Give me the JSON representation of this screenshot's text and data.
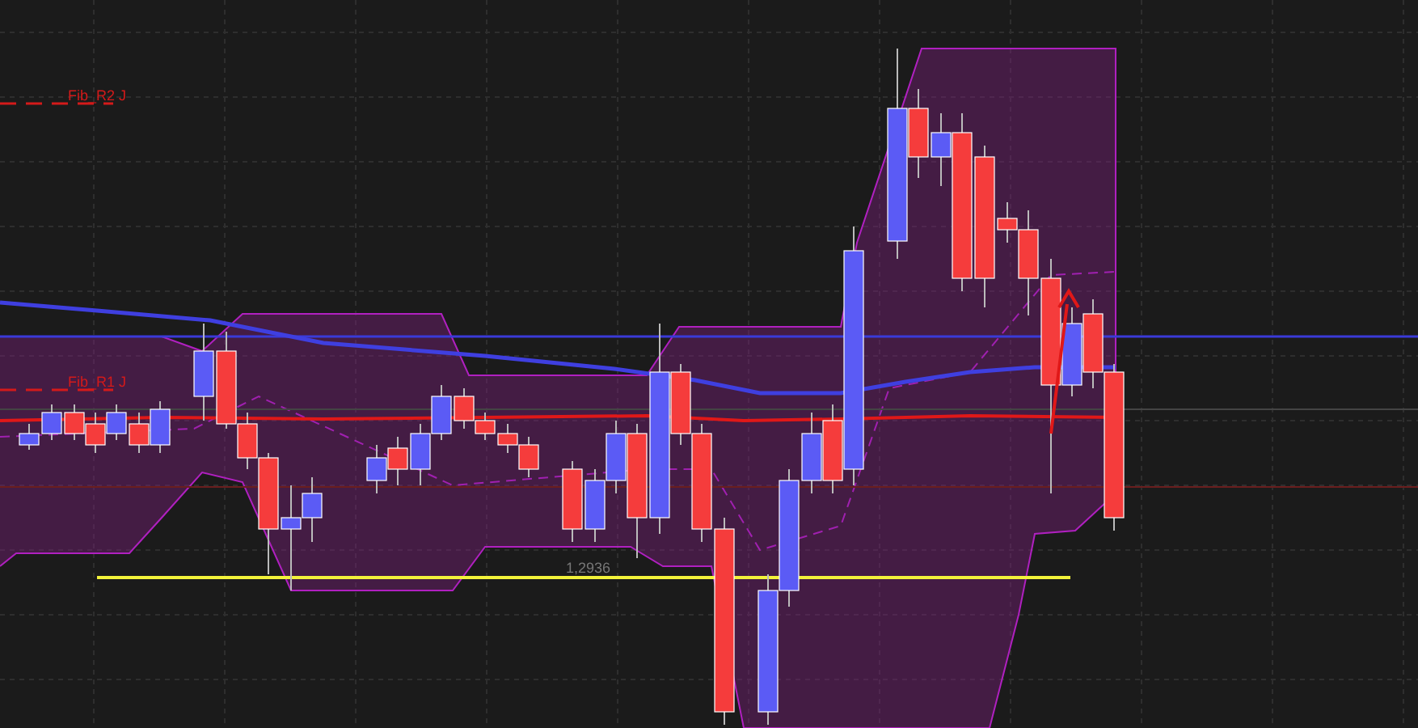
{
  "chart": {
    "labels": [
      {
        "kind": "fib_r2",
        "text": "Fib_R2 J"
      },
      {
        "kind": "fib_r1",
        "text": "Fib_R1 J"
      },
      {
        "kind": "support",
        "text": "1,2936"
      }
    ]
  }
}
